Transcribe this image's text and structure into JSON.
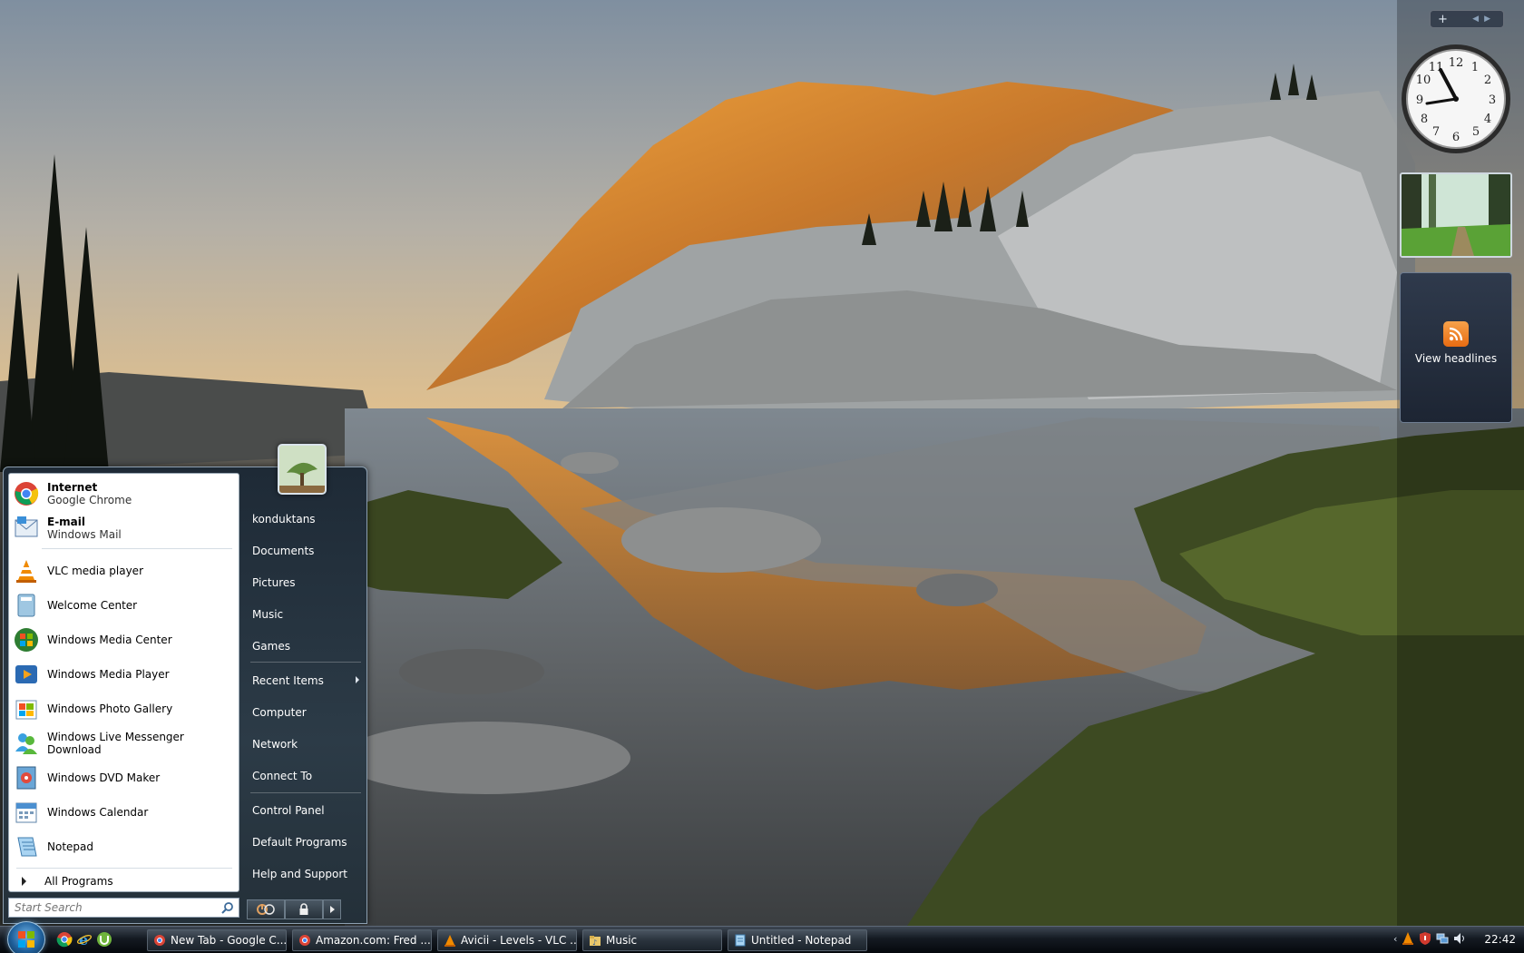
{
  "sidebar": {
    "add_glyph": "+",
    "feed_label": "View headlines"
  },
  "start_menu": {
    "pinned": [
      {
        "main": "Internet",
        "sub": "Google Chrome",
        "icon": "chrome-icon"
      },
      {
        "main": "E-mail",
        "sub": "Windows Mail",
        "icon": "mail-icon"
      }
    ],
    "recent": [
      {
        "label": "VLC media player",
        "icon": "vlc-icon"
      },
      {
        "label": "Welcome Center",
        "icon": "welcome-center-icon"
      },
      {
        "label": "Windows Media Center",
        "icon": "media-center-icon"
      },
      {
        "label": "Windows Media Player",
        "icon": "media-player-icon"
      },
      {
        "label": "Windows Photo Gallery",
        "icon": "photo-gallery-icon"
      },
      {
        "label": "Windows Live Messenger Download",
        "icon": "messenger-icon"
      },
      {
        "label": "Windows DVD Maker",
        "icon": "dvd-maker-icon"
      },
      {
        "label": "Windows Calendar",
        "icon": "calendar-icon"
      },
      {
        "label": "Notepad",
        "icon": "notepad-icon"
      }
    ],
    "all_programs": "All Programs",
    "search_placeholder": "Start Search",
    "places": {
      "user": "konduktans",
      "documents": "Documents",
      "pictures": "Pictures",
      "music": "Music",
      "games": "Games",
      "recent_items": "Recent Items",
      "computer": "Computer",
      "network": "Network",
      "connect_to": "Connect To",
      "control_panel": "Control Panel",
      "default_programs": "Default Programs",
      "help_support": "Help and Support"
    }
  },
  "taskbar": {
    "tasks": [
      {
        "label": "New Tab - Google C...",
        "icon": "chrome-icon"
      },
      {
        "label": "Amazon.com: Fred ...",
        "icon": "chrome-icon"
      },
      {
        "label": "Avicii - Levels - VLC ...",
        "icon": "vlc-icon"
      },
      {
        "label": "Music",
        "icon": "folder-icon"
      },
      {
        "label": "Untitled - Notepad",
        "icon": "notepad-icon"
      }
    ],
    "time": "22:42"
  },
  "colors": {
    "taskbar": "#0b1118",
    "start_menu_right": "#2c3b47",
    "accent": "#6fb3e6"
  }
}
